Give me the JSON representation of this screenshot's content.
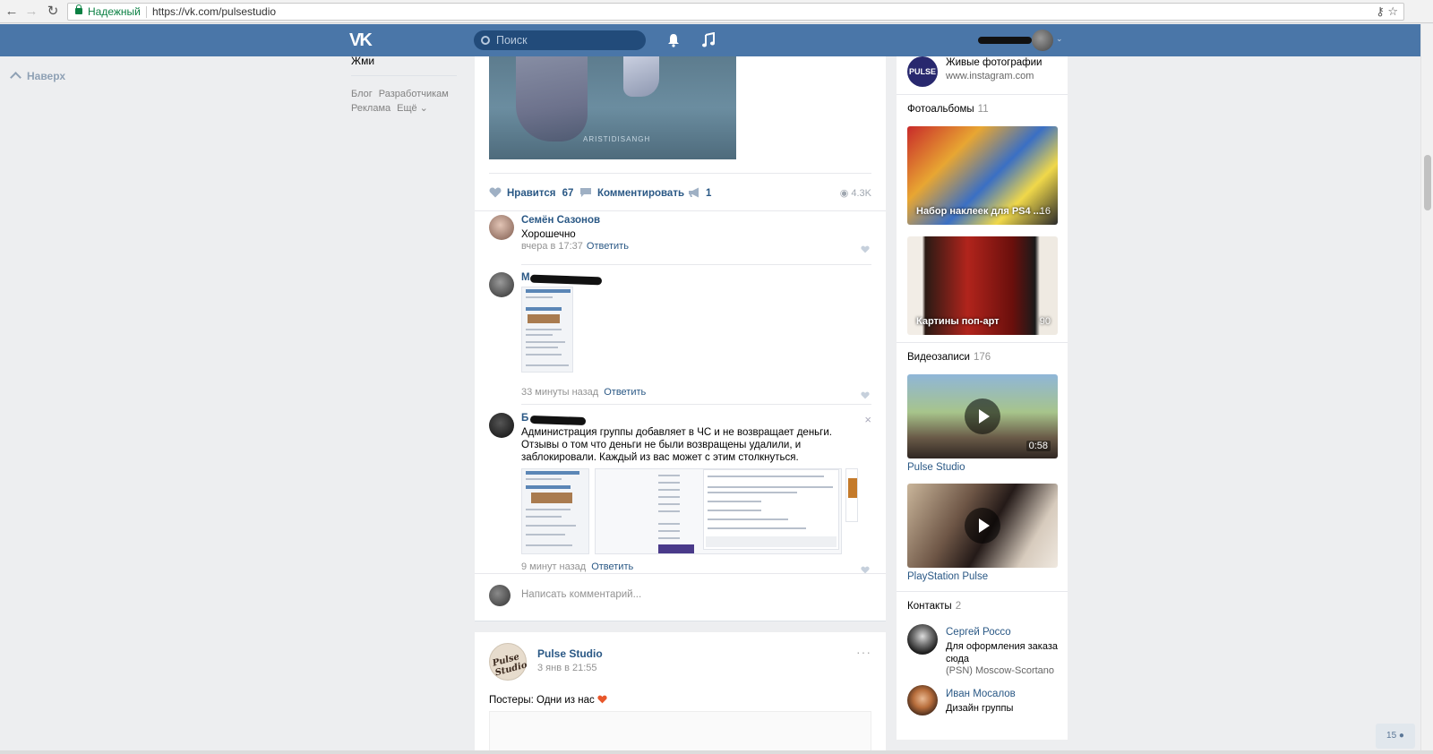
{
  "browser": {
    "secure_label": "Надежный",
    "url": "https://vk.com/pulsestudio"
  },
  "header": {
    "logo": "VK",
    "search_placeholder": "Поиск"
  },
  "left_nav": {
    "up_label": "Наверх",
    "menu_tail": "Жми",
    "footer": [
      "Блог",
      "Разработчикам",
      "Реклама",
      "Ещё ⌄"
    ]
  },
  "post": {
    "image_watermark": "ARISTIDISANGH",
    "like_label": "Нравится",
    "like_count": "67",
    "comment_label": "Комментировать",
    "share_count": "1",
    "views": "4.3K",
    "comments": [
      {
        "author": "Семён Сазонов",
        "text": "Хорошечно",
        "time": "вчера в 17:37",
        "reply": "Ответить"
      },
      {
        "author": "М",
        "text": "",
        "time": "33 минуты назад",
        "reply": "Ответить"
      },
      {
        "author": "Б",
        "text": "Администрация группы добавляет в ЧС и не возвращает деньги. Отзывы о том что деньги не были возвращены удалили, и заблокировали. Каждый из вас может с этим столкнуться.",
        "time": "9 минут назад",
        "reply": "Ответить",
        "close": "×"
      }
    ],
    "new_comment_placeholder": "Написать комментарий..."
  },
  "post2": {
    "author": "Pulse Studio",
    "avatar_text": "Pulse Studio",
    "date": "3 янв в 21:55",
    "text": "Постеры: Одни из нас",
    "more": "···"
  },
  "right": {
    "link": {
      "logo_text": "PULSE",
      "title": "Живые фотографии",
      "url": "www.instagram.com"
    },
    "albums_header": "Фотоальбомы",
    "albums_count": "11",
    "albums": [
      {
        "title": "Набор наклеек для PS4 ...",
        "count": "16"
      },
      {
        "title": "Картины поп-арт",
        "count": "90"
      }
    ],
    "videos_header": "Видеозаписи",
    "videos_count": "176",
    "videos": [
      {
        "title": "Pulse Studio",
        "duration": "0:58"
      },
      {
        "title": "PlayStation Pulse",
        "duration": ""
      }
    ],
    "contacts_header": "Контакты",
    "contacts_count": "2",
    "contacts": [
      {
        "name": "Сергей Россо",
        "desc": "Для оформления заказа сюда",
        "sub": "(PSN) Moscow-Scortano"
      },
      {
        "name": "Иван Мосалов",
        "desc": "Дизайн группы",
        "sub": ""
      }
    ]
  },
  "online_count": "15",
  "colors": {
    "header_blue": "#4a76a8",
    "link_blue": "#2a5885",
    "page_bg": "#edeef0",
    "secure_green": "#0b8043"
  }
}
